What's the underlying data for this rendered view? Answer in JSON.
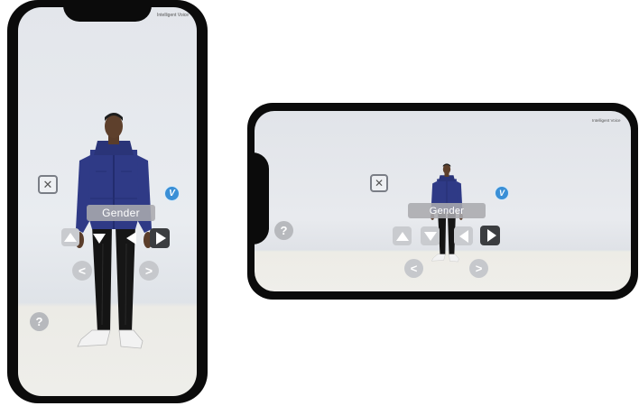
{
  "app": {
    "brand_text": "Intelligent Voice",
    "attribute_label": "Gender"
  },
  "controls": {
    "close_icon": "close-x-icon",
    "confirm_badge": "V",
    "help_label": "?",
    "prev_label": "<",
    "next_label": ">"
  },
  "colors": {
    "jacket": "#2f3a86",
    "pants": "#141414",
    "badge": "#3a8fd6",
    "dark_button": "#3b3d40",
    "light_button": "#c9cbcf"
  }
}
